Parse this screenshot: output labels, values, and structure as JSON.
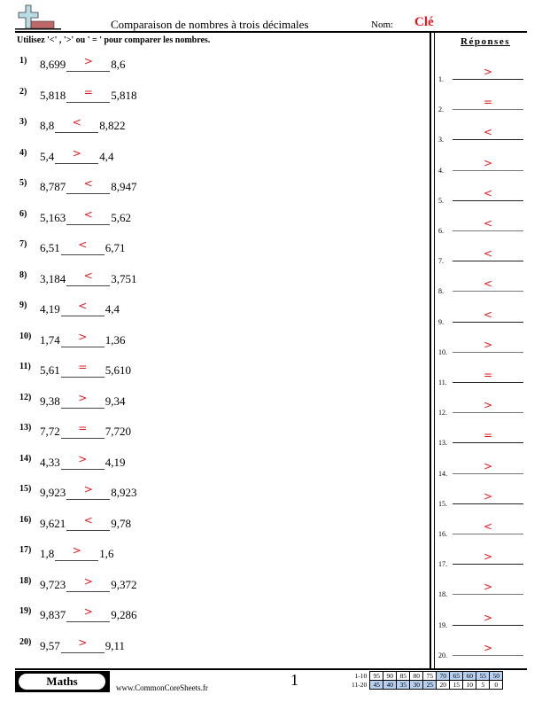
{
  "header": {
    "title": "Comparaison de nombres à trois décimales",
    "nom_label": "Nom:",
    "nom_value": "Clé",
    "instructions": "Utilisez '<' , '>' ou ' = ' pour comparer les nombres.",
    "logo_icon": "plus-sign-logo-icon"
  },
  "answers_header": "Réponses",
  "problems": [
    {
      "num": "1)",
      "left": "8,699",
      "answer": ">",
      "right": "8,6"
    },
    {
      "num": "2)",
      "left": "5,818",
      "answer": "=",
      "right": "5,818"
    },
    {
      "num": "3)",
      "left": "8,8",
      "answer": "<",
      "right": "8,822"
    },
    {
      "num": "4)",
      "left": "5,4",
      "answer": ">",
      "right": "4,4"
    },
    {
      "num": "5)",
      "left": "8,787",
      "answer": "<",
      "right": "8,947"
    },
    {
      "num": "6)",
      "left": "5,163",
      "answer": "<",
      "right": "5,62"
    },
    {
      "num": "7)",
      "left": "6,51",
      "answer": "<",
      "right": "6,71"
    },
    {
      "num": "8)",
      "left": "3,184",
      "answer": "<",
      "right": "3,751"
    },
    {
      "num": "9)",
      "left": "4,19",
      "answer": "<",
      "right": "4,4"
    },
    {
      "num": "10)",
      "left": "1,74",
      "answer": ">",
      "right": "1,36"
    },
    {
      "num": "11)",
      "left": "5,61",
      "answer": "=",
      "right": "5,610"
    },
    {
      "num": "12)",
      "left": "9,38",
      "answer": ">",
      "right": "9,34"
    },
    {
      "num": "13)",
      "left": "7,72",
      "answer": "=",
      "right": "7,720"
    },
    {
      "num": "14)",
      "left": "4,33",
      "answer": ">",
      "right": "4,19"
    },
    {
      "num": "15)",
      "left": "9,923",
      "answer": ">",
      "right": "8,923"
    },
    {
      "num": "16)",
      "left": "9,621",
      "answer": "<",
      "right": "9,78"
    },
    {
      "num": "17)",
      "left": "1,8",
      "answer": ">",
      "right": "1,6"
    },
    {
      "num": "18)",
      "left": "9,723",
      "answer": ">",
      "right": "9,372"
    },
    {
      "num": "19)",
      "left": "9,837",
      "answer": ">",
      "right": "9,286"
    },
    {
      "num": "20)",
      "left": "9,57",
      "answer": ">",
      "right": "9,11"
    }
  ],
  "answer_key": [
    {
      "num": "1.",
      "value": ">"
    },
    {
      "num": "2.",
      "value": "="
    },
    {
      "num": "3.",
      "value": "<"
    },
    {
      "num": "4.",
      "value": ">"
    },
    {
      "num": "5.",
      "value": "<"
    },
    {
      "num": "6.",
      "value": "<"
    },
    {
      "num": "7.",
      "value": "<"
    },
    {
      "num": "8.",
      "value": "<"
    },
    {
      "num": "9.",
      "value": "<"
    },
    {
      "num": "10.",
      "value": ">"
    },
    {
      "num": "11.",
      "value": "="
    },
    {
      "num": "12.",
      "value": ">"
    },
    {
      "num": "13.",
      "value": "="
    },
    {
      "num": "14.",
      "value": ">"
    },
    {
      "num": "15.",
      "value": ">"
    },
    {
      "num": "16.",
      "value": "<"
    },
    {
      "num": "17.",
      "value": ">"
    },
    {
      "num": "18.",
      "value": ">"
    },
    {
      "num": "19.",
      "value": ">"
    },
    {
      "num": "20.",
      "value": ">"
    }
  ],
  "footer": {
    "subject": "Maths",
    "url": "www.CommonCoreSheets.fr",
    "page": "1",
    "score_rows": [
      {
        "label": "1-10",
        "scores": [
          "95",
          "90",
          "85",
          "80",
          "75",
          "70",
          "65",
          "60",
          "55",
          "50"
        ],
        "highlight_from": 5,
        "highlight_to": 9
      },
      {
        "label": "11-20",
        "scores": [
          "45",
          "40",
          "35",
          "30",
          "25",
          "20",
          "15",
          "10",
          "5",
          "0"
        ],
        "highlight_from": 0,
        "highlight_to": 4
      }
    ]
  },
  "colors": {
    "answer_red": "#e8161b",
    "score_highlight": "#b8d0ef",
    "logo_cross": "#b9dde6",
    "logo_bar": "#c0676a"
  }
}
